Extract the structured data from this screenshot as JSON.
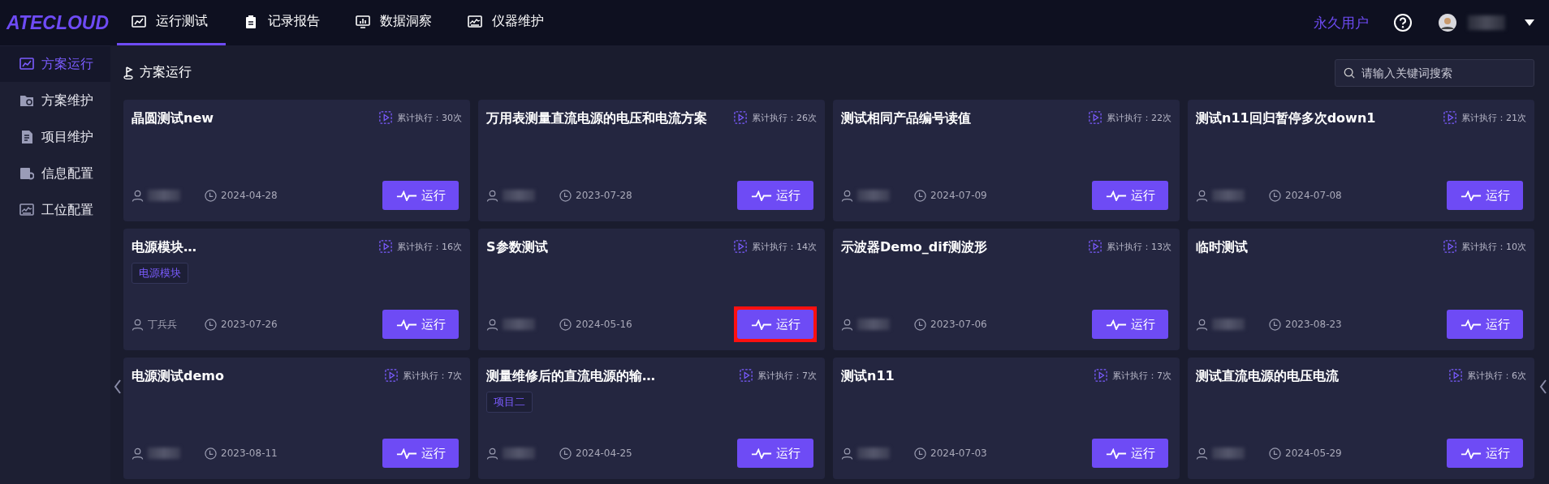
{
  "app": {
    "logo": "ATECLOUD"
  },
  "nav_tabs": [
    {
      "label": "运行测试",
      "selected": true
    },
    {
      "label": "记录报告",
      "selected": false
    },
    {
      "label": "数据洞察",
      "selected": false
    },
    {
      "label": "仪器维护",
      "selected": false
    }
  ],
  "user": {
    "license": "永久用户"
  },
  "sidebar": {
    "items": [
      {
        "label": "方案运行",
        "selected": true
      },
      {
        "label": "方案维护",
        "selected": false
      },
      {
        "label": "项目维护",
        "selected": false
      },
      {
        "label": "信息配置",
        "selected": false
      },
      {
        "label": "工位配置",
        "selected": false
      }
    ]
  },
  "breadcrumb": "方案运行",
  "search": {
    "placeholder": "请输入关键词搜索"
  },
  "cards": [
    {
      "title": "晶圆测试new",
      "runs": "累计执行：30次",
      "date": "2024-04-28",
      "button": "运行",
      "highlighted": false
    },
    {
      "title": "万用表测量直流电源的电压和电流方案",
      "runs": "累计执行：26次",
      "date": "2023-07-28",
      "button": "运行",
      "highlighted": false
    },
    {
      "title": "测试相同产品编号读值",
      "runs": "累计执行：22次",
      "date": "2024-07-09",
      "button": "运行",
      "highlighted": false
    },
    {
      "title": "测试n11回归暂停多次down1",
      "runs": "累计执行：21次",
      "date": "2024-07-08",
      "button": "运行",
      "highlighted": false
    },
    {
      "title": "电源模块…",
      "tags": [
        "电源模块"
      ],
      "runs": "累计执行：16次",
      "author": "丁兵兵",
      "date": "2023-07-26",
      "button": "运行",
      "highlighted": false
    },
    {
      "title": "S参数测试",
      "runs": "累计执行：14次",
      "date": "2024-05-16",
      "button": "运行",
      "highlighted": true
    },
    {
      "title": "示波器Demo_dif测波形",
      "runs": "累计执行：13次",
      "date": "2023-07-06",
      "button": "运行",
      "highlighted": false
    },
    {
      "title": "临时测试",
      "runs": "累计执行：10次",
      "date": "2023-08-23",
      "button": "运行",
      "highlighted": false
    },
    {
      "title": "电源测试demo",
      "runs": "累计执行：7次",
      "date": "2023-08-11",
      "button": "运行",
      "highlighted": false
    },
    {
      "title": "测量维修后的直流电源的输…",
      "tags": [
        "项目二"
      ],
      "runs": "累计执行：7次",
      "date": "2024-04-25",
      "button": "运行",
      "highlighted": false
    },
    {
      "title": "测试n11",
      "runs": "累计执行：7次",
      "date": "2024-07-03",
      "button": "运行",
      "highlighted": false
    },
    {
      "title": "测试直流电源的电压电流",
      "runs": "累计执行：6次",
      "date": "2024-05-29",
      "button": "运行",
      "highlighted": false
    }
  ]
}
